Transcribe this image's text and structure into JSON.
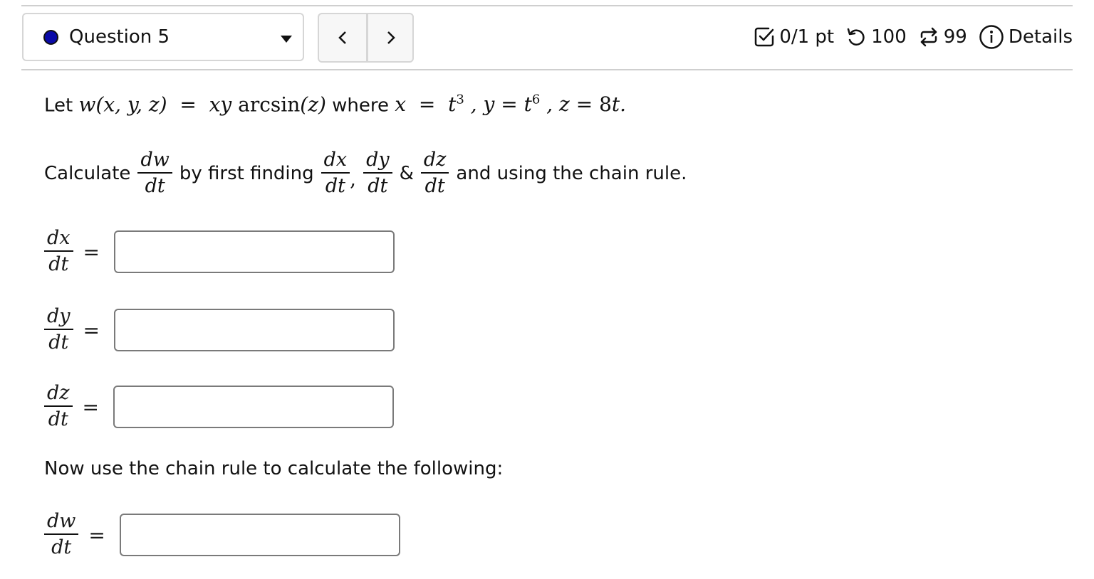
{
  "header": {
    "question_label": "Question 5",
    "status_dot_color": "#0a0aa8",
    "prev_label": "<",
    "next_label": ">",
    "score": "0/1 pt",
    "retries": "100",
    "attempts": "99",
    "details_label": "Details",
    "icons": {
      "score": "checkbox-icon",
      "retries": "undo-icon",
      "attempts": "repeat-icon",
      "details": "info-icon",
      "dropdown": "caret-down-icon"
    }
  },
  "problem": {
    "intro_let": "Let",
    "function_def": "w(x, y, z) = xy arcsin(z)",
    "where": "where",
    "substitutions": "x = t³ , y = t⁶ , z = 8t.",
    "calc_prefix": "Calculate",
    "calc_middle": "by first finding",
    "comma": ",",
    "amp": "&",
    "calc_suffix": "and using the chain rule.",
    "now_text": "Now use the chain rule to calculate the following:"
  },
  "fractions": {
    "dw": {
      "num": "dw",
      "den": "dt"
    },
    "dx": {
      "num": "dx",
      "den": "dt"
    },
    "dy": {
      "num": "dy",
      "den": "dt"
    },
    "dz": {
      "num": "dz",
      "den": "dt"
    }
  },
  "equals": "=",
  "answers": {
    "dx_dt": {
      "value": "",
      "placeholder": ""
    },
    "dy_dt": {
      "value": "",
      "placeholder": ""
    },
    "dz_dt": {
      "value": "",
      "placeholder": ""
    },
    "dw_dt": {
      "value": "",
      "placeholder": ""
    }
  }
}
